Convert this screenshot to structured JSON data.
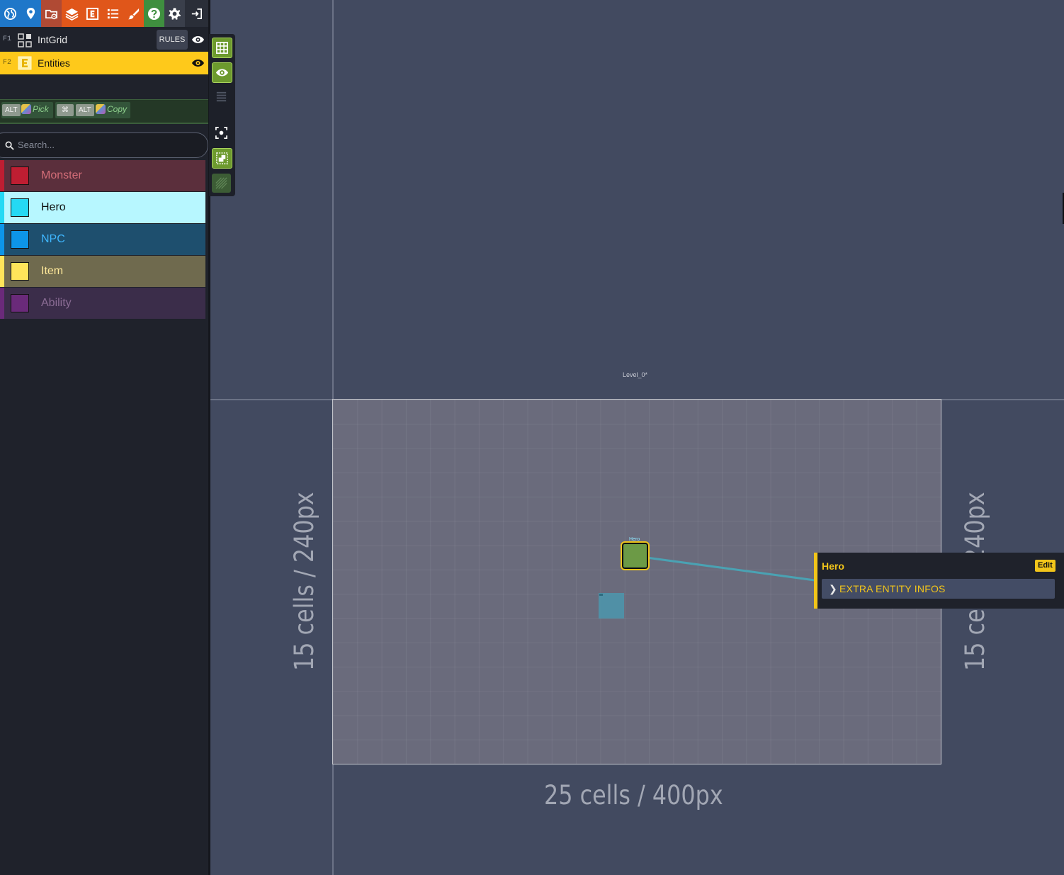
{
  "toolbar": {
    "icons": [
      "world-icon",
      "pin-icon",
      "folder-gear-icon",
      "layers-icon",
      "entity-e-icon",
      "list-icon",
      "brush-icon",
      "help-icon",
      "settings-icon",
      "exit-icon"
    ],
    "colors": {
      "blue": "#1f77c9",
      "red": "#b04a34",
      "orange": "#e0561a",
      "green": "#3f8f3f",
      "gray": "#3a3f4b"
    }
  },
  "layers": [
    {
      "key": "F1",
      "name": "IntGrid",
      "badge": "RULES",
      "icon": "intgrid-icon"
    },
    {
      "key": "F2",
      "name": "Entities",
      "icon": "entity-e-icon",
      "active": true
    }
  ],
  "shortcuts": {
    "pick_key": "ALT",
    "pick_label": "Pick",
    "copy_key1": "⌘",
    "copy_key2": "ALT",
    "copy_label": "Copy"
  },
  "search": {
    "placeholder": "Search..."
  },
  "entities": [
    {
      "name": "Monster",
      "color": "#be1e32",
      "bg": "#5b2f3c",
      "text": "#d26c77"
    },
    {
      "name": "Hero",
      "color": "#25d9f4",
      "bg": "#b7f7ff",
      "text": "#0d0d0d",
      "selected": true
    },
    {
      "name": "NPC",
      "color": "#0d95e8",
      "bg": "#1e4f6e",
      "text": "#3fb7ff"
    },
    {
      "name": "Item",
      "color": "#ffe55a",
      "bg": "#6f6a4e",
      "text": "#ffe99a"
    },
    {
      "name": "Ability",
      "color": "#6a2a7a",
      "bg": "#3b2d4a",
      "text": "#8a6c94"
    }
  ],
  "side_tools": [
    "grid-toggle-icon",
    "eye-toggle-icon",
    "details-list-icon",
    "focus-icon",
    "single-layer-icon",
    "tile-stamp-icon"
  ],
  "canvas": {
    "level_name": "Level_0*",
    "width_label": "25 cells / 400px",
    "height_label_left": "15 cells / 240px",
    "height_label_right": "15 cells / 240px",
    "hero_tag": "Hero"
  },
  "popup": {
    "title": "Hero",
    "edit_label": "Edit",
    "extra_label": "EXTRA ENTITY INFOS"
  }
}
